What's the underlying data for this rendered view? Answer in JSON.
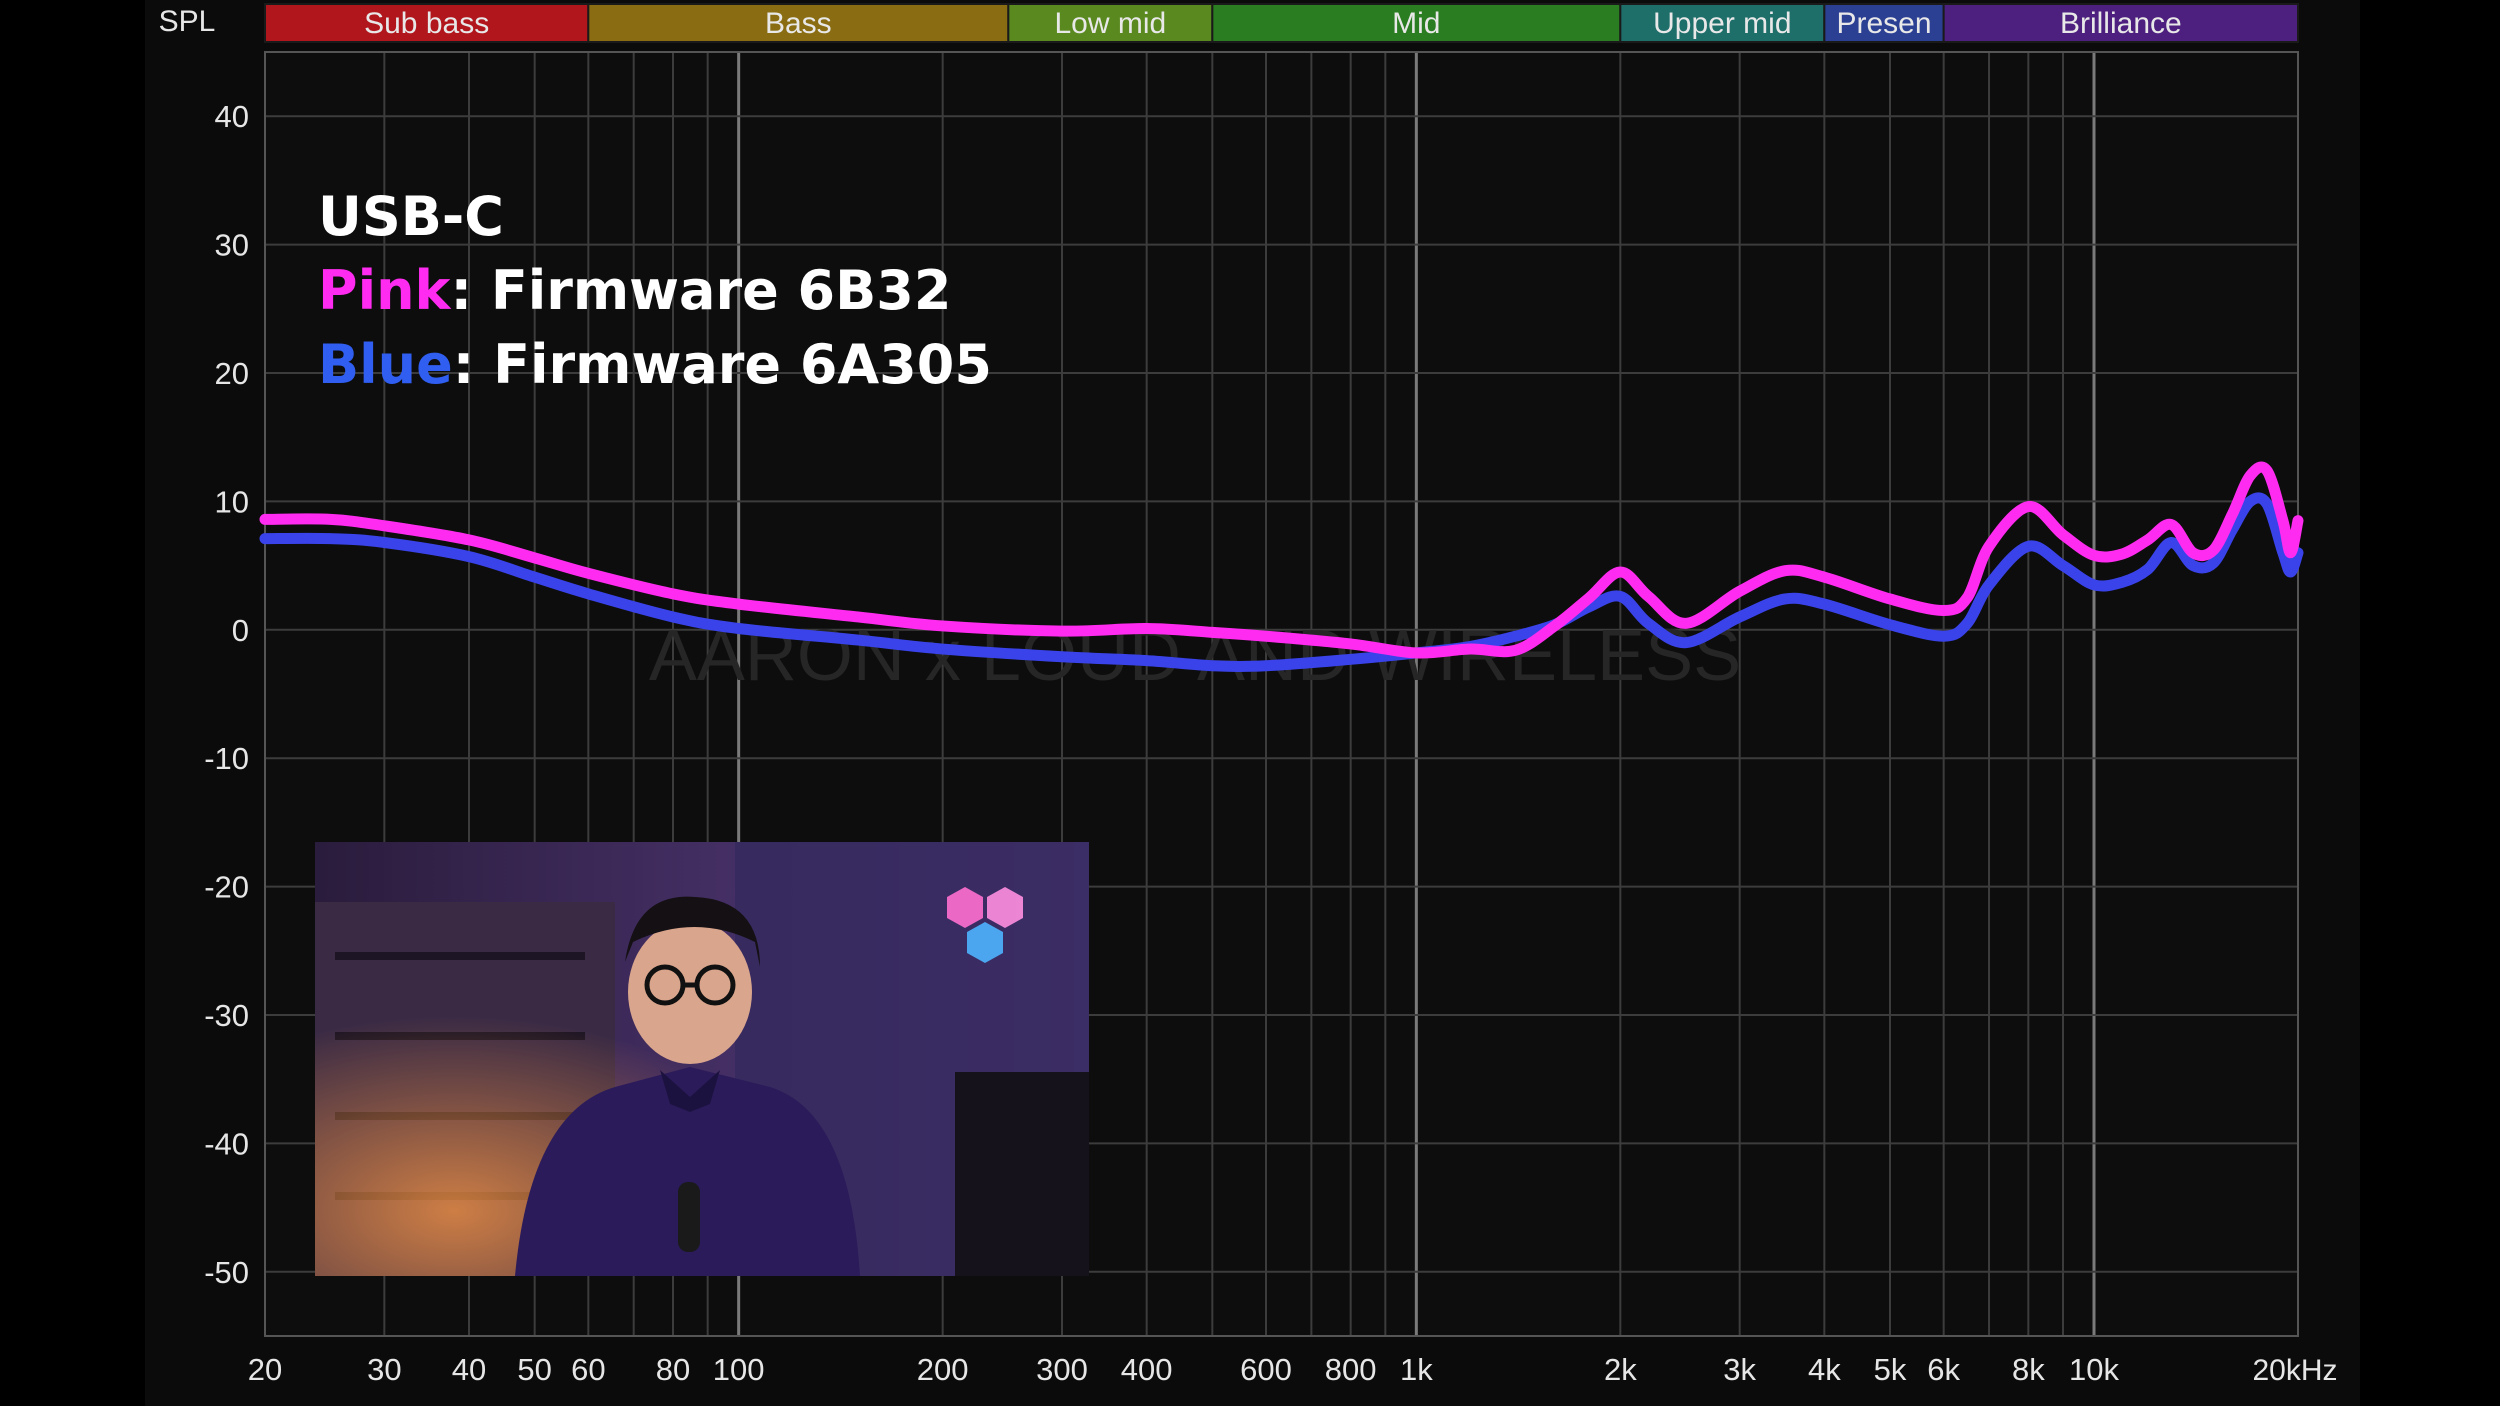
{
  "chart_data": {
    "type": "line",
    "ylabel": "SPL",
    "xunit": "20kHz",
    "xscale": "log",
    "xlim": [
      20,
      20000
    ],
    "ylim": [
      -55,
      45
    ],
    "grid": true,
    "bands": [
      {
        "label": "Sub bass",
        "from": 20,
        "to": 60,
        "color": "#b1161d"
      },
      {
        "label": "Bass",
        "from": 60,
        "to": 250,
        "color": "#8a6d12"
      },
      {
        "label": "Low mid",
        "from": 250,
        "to": 500,
        "color": "#5a8a1f"
      },
      {
        "label": "Mid",
        "from": 500,
        "to": 2000,
        "color": "#2a7d20"
      },
      {
        "label": "Upper mid",
        "from": 2000,
        "to": 4000,
        "color": "#1e6e6a"
      },
      {
        "label": "Presen",
        "from": 4000,
        "to": 6000,
        "color": "#2b3f93"
      },
      {
        "label": "Brilliance",
        "from": 6000,
        "to": 20000,
        "color": "#4d1f7e"
      }
    ],
    "yticks": [
      40,
      30,
      20,
      10,
      0,
      -10,
      -20,
      -30,
      -40,
      -50
    ],
    "xticks": [
      {
        "v": 20,
        "label": "20"
      },
      {
        "v": 30,
        "label": "30"
      },
      {
        "v": 40,
        "label": "40"
      },
      {
        "v": 50,
        "label": "50"
      },
      {
        "v": 60,
        "label": "60"
      },
      {
        "v": 80,
        "label": "80"
      },
      {
        "v": 100,
        "label": "100"
      },
      {
        "v": 200,
        "label": "200"
      },
      {
        "v": 300,
        "label": "300"
      },
      {
        "v": 400,
        "label": "400"
      },
      {
        "v": 600,
        "label": "600"
      },
      {
        "v": 800,
        "label": "800"
      },
      {
        "v": 1000,
        "label": "1k"
      },
      {
        "v": 2000,
        "label": "2k"
      },
      {
        "v": 3000,
        "label": "3k"
      },
      {
        "v": 4000,
        "label": "4k"
      },
      {
        "v": 5000,
        "label": "5k"
      },
      {
        "v": 6000,
        "label": "6k"
      },
      {
        "v": 8000,
        "label": "8k"
      },
      {
        "v": 10000,
        "label": "10k"
      }
    ],
    "series": [
      {
        "name": "Firmware 6B32",
        "color": "#ff2bf0",
        "points": [
          [
            20,
            8.6
          ],
          [
            25,
            8.6
          ],
          [
            30,
            8.1
          ],
          [
            40,
            7.0
          ],
          [
            50,
            5.6
          ],
          [
            60,
            4.4
          ],
          [
            80,
            2.8
          ],
          [
            100,
            2.0
          ],
          [
            150,
            1.0
          ],
          [
            200,
            0.3
          ],
          [
            300,
            -0.1
          ],
          [
            400,
            0.1
          ],
          [
            500,
            -0.2
          ],
          [
            600,
            -0.5
          ],
          [
            800,
            -1.1
          ],
          [
            1000,
            -1.8
          ],
          [
            1200,
            -1.5
          ],
          [
            1400,
            -1.6
          ],
          [
            1600,
            0.3
          ],
          [
            1800,
            2.5
          ],
          [
            2000,
            4.5
          ],
          [
            2200,
            2.6
          ],
          [
            2500,
            0.5
          ],
          [
            3000,
            3.0
          ],
          [
            3500,
            4.6
          ],
          [
            4000,
            4.1
          ],
          [
            5000,
            2.4
          ],
          [
            6000,
            1.5
          ],
          [
            6500,
            2.5
          ],
          [
            7000,
            6.5
          ],
          [
            8000,
            9.6
          ],
          [
            9000,
            7.4
          ],
          [
            10000,
            5.8
          ],
          [
            11000,
            5.9
          ],
          [
            12000,
            7.0
          ],
          [
            13000,
            8.2
          ],
          [
            14000,
            6.0
          ],
          [
            15000,
            6.2
          ],
          [
            16000,
            9.0
          ],
          [
            17000,
            12.0
          ],
          [
            18000,
            12.4
          ],
          [
            19000,
            8.5
          ],
          [
            19500,
            6.0
          ],
          [
            20000,
            8.5
          ]
        ]
      },
      {
        "name": "Firmware 6A305",
        "color": "#3a43ea",
        "points": [
          [
            20,
            7.1
          ],
          [
            25,
            7.1
          ],
          [
            30,
            6.8
          ],
          [
            40,
            5.7
          ],
          [
            50,
            4.1
          ],
          [
            60,
            2.8
          ],
          [
            80,
            1.0
          ],
          [
            100,
            0.1
          ],
          [
            150,
            -0.8
          ],
          [
            200,
            -1.5
          ],
          [
            300,
            -2.1
          ],
          [
            400,
            -2.4
          ],
          [
            500,
            -2.8
          ],
          [
            600,
            -2.8
          ],
          [
            800,
            -2.3
          ],
          [
            1000,
            -1.8
          ],
          [
            1200,
            -1.3
          ],
          [
            1400,
            -0.5
          ],
          [
            1600,
            0.4
          ],
          [
            1800,
            1.8
          ],
          [
            2000,
            2.6
          ],
          [
            2200,
            0.5
          ],
          [
            2500,
            -1.0
          ],
          [
            3000,
            1.0
          ],
          [
            3500,
            2.4
          ],
          [
            4000,
            2.0
          ],
          [
            5000,
            0.4
          ],
          [
            6000,
            -0.5
          ],
          [
            6500,
            0.5
          ],
          [
            7000,
            3.5
          ],
          [
            8000,
            6.5
          ],
          [
            9000,
            5.0
          ],
          [
            10000,
            3.5
          ],
          [
            11000,
            3.7
          ],
          [
            12000,
            4.7
          ],
          [
            13000,
            6.8
          ],
          [
            14000,
            5.0
          ],
          [
            15000,
            5.2
          ],
          [
            16000,
            7.8
          ],
          [
            17000,
            10.0
          ],
          [
            18000,
            9.8
          ],
          [
            19000,
            6.0
          ],
          [
            19500,
            4.5
          ],
          [
            20000,
            6.0
          ]
        ]
      }
    ]
  },
  "legend": {
    "title": "USB-C",
    "pink_word": "Pink",
    "pink_text": ": Firmware 6B32",
    "blue_word": "Blue",
    "blue_text": ": Firmware 6A305",
    "pink_color": "#ff2bf0",
    "blue_color": "#2f5ef0"
  },
  "watermark": "AARON x LOUD AND WIRELESS"
}
